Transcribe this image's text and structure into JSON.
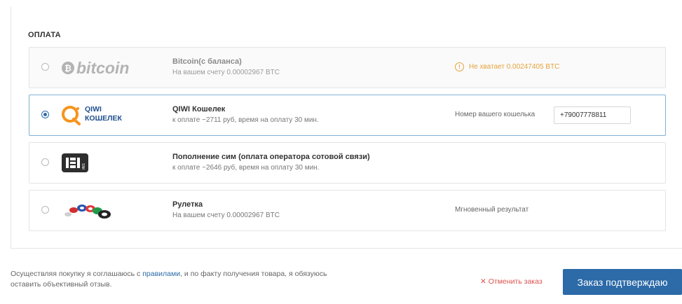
{
  "section": {
    "title": "ОПЛАТА"
  },
  "options": [
    {
      "logo": "bitcoin",
      "title": "Bitcoin(с баланса)",
      "subtitle": "На вашем счету 0.00002967 BTC",
      "warning": "Не хватает 0.00247405 BTC",
      "selected": false,
      "disabled": true
    },
    {
      "logo": "qiwi-wallet",
      "logo_text_line1": "QIWI",
      "logo_text_line2": "КОШЕЛЕК",
      "title": "QIWI Кошелек",
      "subtitle": "к оплате ~2711 руб, время на оплату 30 мин.",
      "right_label": "Номер вашего кошелька",
      "input_value": "+79007778811",
      "selected": true
    },
    {
      "logo": "sim-card",
      "title": "Пополнение сим (оплата оператора сотовой связи)",
      "subtitle": "к оплате ~2646 руб, время на оплату 30 мин.",
      "selected": false
    },
    {
      "logo": "casino-chips",
      "title": "Рулетка",
      "subtitle": "На вашем счету 0.00002967 BTC",
      "right_label": "Мгновенный результат",
      "selected": false
    }
  ],
  "footer": {
    "agreement_before": "Осуществляя покупку я соглашаюсь с ",
    "agreement_link": "правилами",
    "agreement_after": ", и по факту получения товара, я обязуюсь оставить объективный отзыв.",
    "cancel_label": "Отменить заказ",
    "confirm_label": "Заказ подтверждаю"
  },
  "colors": {
    "accent": "#2c6aa8",
    "warning": "#e7a23b",
    "cancel": "#d9534f",
    "qiwi_orange": "#f7941d",
    "qiwi_blue": "#1f4f8f"
  }
}
